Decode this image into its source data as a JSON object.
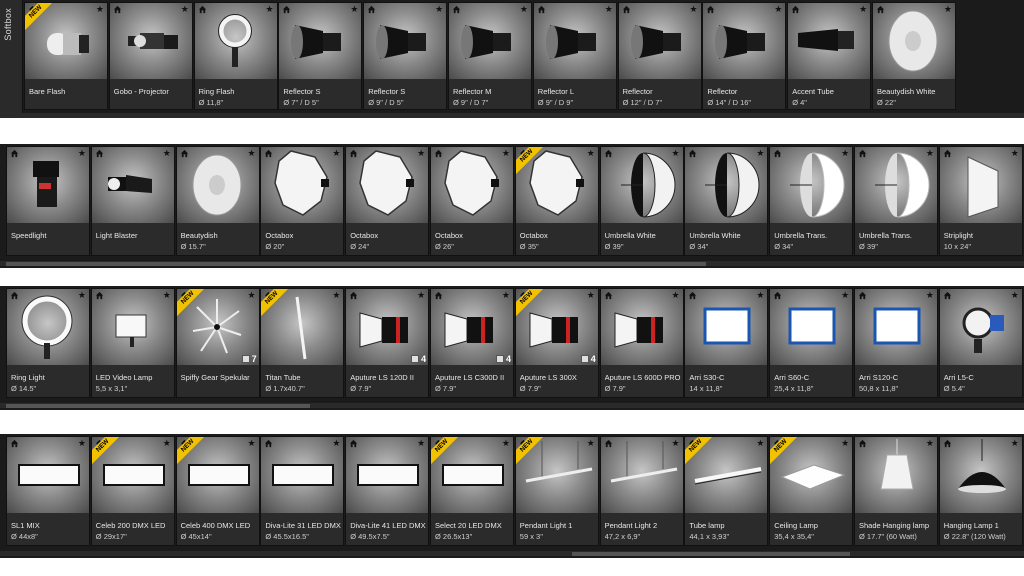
{
  "strip1": {
    "tab_label": "Softbox",
    "cards": [
      {
        "name": "Bare Flash",
        "sub": "",
        "isNew": true,
        "icon": "bare-flash-icon"
      },
      {
        "name": "Gobo - Projector",
        "sub": "",
        "isNew": false,
        "icon": "gobo-projector-icon"
      },
      {
        "name": "Ring Flash",
        "sub": "Ø 11,8\"",
        "isNew": false,
        "icon": "ring-flash-icon"
      },
      {
        "name": "Reflector S",
        "sub": "Ø 7\" / D 5\"",
        "isNew": false,
        "icon": "reflector-icon"
      },
      {
        "name": "Reflector S",
        "sub": "Ø 9\" / D 5\"",
        "isNew": false,
        "icon": "reflector-icon"
      },
      {
        "name": "Reflector M",
        "sub": "Ø 9\" / D 7\"",
        "isNew": false,
        "icon": "reflector-icon"
      },
      {
        "name": "Reflector L",
        "sub": "Ø 9\" / D 9\"",
        "isNew": false,
        "icon": "reflector-icon"
      },
      {
        "name": "Reflector",
        "sub": "Ø 12\" / D 7\"",
        "isNew": false,
        "icon": "reflector-icon"
      },
      {
        "name": "Reflector",
        "sub": "Ø 14\" / D 16\"",
        "isNew": false,
        "icon": "reflector-icon"
      },
      {
        "name": "Accent Tube",
        "sub": "Ø 4\"",
        "isNew": false,
        "icon": "accent-tube-icon"
      },
      {
        "name": "Beautydish White",
        "sub": "Ø 22\"",
        "isNew": false,
        "icon": "beautydish-icon"
      }
    ]
  },
  "strip2": {
    "cards": [
      {
        "name": "Speedlight",
        "sub": "",
        "isNew": false,
        "icon": "speedlight-icon"
      },
      {
        "name": "Light Blaster",
        "sub": "",
        "isNew": false,
        "icon": "light-blaster-icon"
      },
      {
        "name": "Beautydish",
        "sub": "Ø 15.7\"",
        "isNew": false,
        "icon": "beautydish-icon"
      },
      {
        "name": "Octabox",
        "sub": "Ø 20\"",
        "isNew": false,
        "icon": "octabox-icon"
      },
      {
        "name": "Octabox",
        "sub": "Ø 24\"",
        "isNew": false,
        "icon": "octabox-icon"
      },
      {
        "name": "Octabox",
        "sub": "Ø 26\"",
        "isNew": false,
        "icon": "octabox-icon"
      },
      {
        "name": "Octabox",
        "sub": "Ø 35\"",
        "isNew": true,
        "icon": "octabox-icon"
      },
      {
        "name": "Umbrella White",
        "sub": "Ø 39\"",
        "isNew": false,
        "icon": "umbrella-icon"
      },
      {
        "name": "Umbrella White",
        "sub": "Ø 34\"",
        "isNew": false,
        "icon": "umbrella-icon"
      },
      {
        "name": "Umbrella Trans.",
        "sub": "Ø 34\"",
        "isNew": false,
        "icon": "umbrella-trans-icon"
      },
      {
        "name": "Umbrella Trans.",
        "sub": "Ø 39\"",
        "isNew": false,
        "icon": "umbrella-trans-icon"
      },
      {
        "name": "Striplight",
        "sub": "10 x 24\"",
        "isNew": false,
        "icon": "striplight-icon"
      }
    ]
  },
  "strip3": {
    "cards": [
      {
        "name": "Ring Light",
        "sub": "Ø 14.5\"",
        "isNew": false,
        "icon": "ring-light-icon",
        "count": ""
      },
      {
        "name": "LED Video Lamp",
        "sub": "5,5 x 3,1\"",
        "isNew": false,
        "icon": "led-panel-icon",
        "count": ""
      },
      {
        "name": "Spiffy Gear Spekular",
        "sub": "",
        "isNew": true,
        "icon": "spekular-icon",
        "count": "7"
      },
      {
        "name": "Titan Tube",
        "sub": "Ø 1.7x40.7\"",
        "isNew": true,
        "icon": "tube-icon",
        "count": ""
      },
      {
        "name": "Aputure LS 120D II",
        "sub": "Ø 7.9\"",
        "isNew": false,
        "icon": "aputure-icon",
        "count": "4"
      },
      {
        "name": "Aputure LS C300D II",
        "sub": "Ø 7.9\"",
        "isNew": false,
        "icon": "aputure-icon",
        "count": "4"
      },
      {
        "name": "Aputure LS 300X",
        "sub": "Ø 7.9\"",
        "isNew": true,
        "icon": "aputure-icon",
        "count": "4"
      },
      {
        "name": "Aputure LS 600D PRO",
        "sub": "Ø 7.9\"",
        "isNew": false,
        "icon": "aputure-icon",
        "count": ""
      },
      {
        "name": "Arri S30-C",
        "sub": "14 x 11,8\"",
        "isNew": false,
        "icon": "arri-panel-icon",
        "count": ""
      },
      {
        "name": "Arri S60-C",
        "sub": "25,4 x 11,8\"",
        "isNew": false,
        "icon": "arri-panel-icon",
        "count": ""
      },
      {
        "name": "Arri S120-C",
        "sub": "50,8 x 11,8\"",
        "isNew": false,
        "icon": "arri-panel-icon",
        "count": ""
      },
      {
        "name": "Arri L5-C",
        "sub": "Ø 5.4\"",
        "isNew": false,
        "icon": "arri-fresnel-icon",
        "count": ""
      }
    ]
  },
  "strip4": {
    "cards": [
      {
        "name": "SL1 MIX",
        "sub": "Ø 44x8\"",
        "isNew": false,
        "icon": "led-bar-icon"
      },
      {
        "name": "Celeb 200 DMX LED",
        "sub": "Ø 29x17\"",
        "isNew": true,
        "icon": "led-bar-icon"
      },
      {
        "name": "Celeb 400 DMX LED",
        "sub": "Ø 45x14\"",
        "isNew": true,
        "icon": "led-bar-icon"
      },
      {
        "name": "Diva-Lite 31 LED DMX",
        "sub": "Ø 45.5x16.5\"",
        "isNew": false,
        "icon": "led-bar-icon"
      },
      {
        "name": "Diva-Lite 41 LED DMX",
        "sub": "Ø 49.5x7.5\"",
        "isNew": false,
        "icon": "led-bar-icon"
      },
      {
        "name": "Select 20 LED DMX",
        "sub": "Ø 26.5x13\"",
        "isNew": true,
        "icon": "led-bar-icon"
      },
      {
        "name": "Pendant Light 1",
        "sub": "59 x  3\"",
        "isNew": true,
        "icon": "pendant-light-icon"
      },
      {
        "name": "Pendant Light 2",
        "sub": "47,2 x  6,9\"",
        "isNew": false,
        "icon": "pendant-light-icon"
      },
      {
        "name": "Tube lamp",
        "sub": "44,1 x  3,93\"",
        "isNew": true,
        "icon": "tube-lamp-icon"
      },
      {
        "name": "Ceiling Lamp",
        "sub": "35,4 x  35,4\"",
        "isNew": true,
        "icon": "ceiling-lamp-icon"
      },
      {
        "name": "Shade Hanging lamp",
        "sub": "Ø 17.7\" (60 Watt)",
        "isNew": false,
        "icon": "shade-lamp-icon"
      },
      {
        "name": "Hanging Lamp 1",
        "sub": "Ø 22.8\" (120 Watt)",
        "isNew": false,
        "icon": "hanging-lamp-icon"
      }
    ]
  },
  "badge_label": "NEW"
}
